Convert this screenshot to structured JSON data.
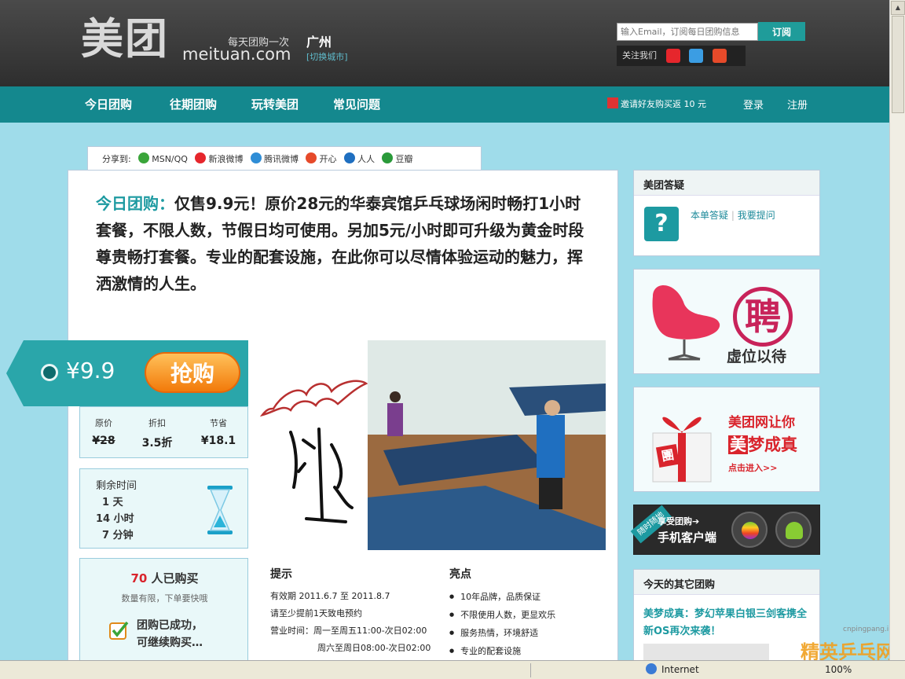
{
  "header": {
    "logo_cn": "美团",
    "logo_en": "meituan.com",
    "slogan": "每天团购一次",
    "city": "广州",
    "city_switch": "[切换城市]",
    "subscribe_placeholder": "输入Email，订阅每日团购信息",
    "subscribe_button": "订阅",
    "follow_label": "关注我们"
  },
  "nav": {
    "items": [
      "今日团购",
      "往期团购",
      "玩转美团",
      "常见问题"
    ],
    "invite": "邀请好友购买返 10 元",
    "login": "登录",
    "register": "注册"
  },
  "share": {
    "label": "分享到:",
    "items": [
      "MSN/QQ",
      "新浪微博",
      "腾讯微博",
      "开心",
      "人人",
      "豆瓣"
    ]
  },
  "deal": {
    "title_prefix": "今日团购：",
    "title": "仅售9.9元！原价28元的华泰宾馆乒乓球场闲时畅打1小时套餐，不限人数，节假日均可使用。另加5元/小时即可升级为黄金时段尊贵畅打套餐。专业的配套设施，在此你可以尽情体验运动的魅力，挥洒激情的人生。",
    "price": "¥9.9",
    "buy_button": "抢购",
    "original_label": "原价",
    "original_value": "¥28",
    "discount_label": "折扣",
    "discount_value": "3.5折",
    "save_label": "节省",
    "save_value": "¥18.1",
    "remaining_label": "剩余时间",
    "remaining_days": "1 天",
    "remaining_hours": "14 小时",
    "remaining_minutes": "7 分钟",
    "buyers_count": "70",
    "buyers_text": "人已购买",
    "limited_text": "数量有限，下单要快哦",
    "success_line1": "团购已成功，",
    "success_line2": "可继续购买…"
  },
  "tips": {
    "title": "提示",
    "lines": [
      "有效期 2011.6.7 至 2011.8.7",
      "请至少提前1天致电预约",
      "营业时间：周一至周五11:00-次日02:00",
      "周六至周日08:00-次日02:00"
    ]
  },
  "highlights": {
    "title": "亮点",
    "items": [
      "10年品牌，品质保证",
      "不限使用人数，更显欢乐",
      "服务热情，环境舒适",
      "专业的配套设施"
    ]
  },
  "sidebar": {
    "qa_title": "美团答疑",
    "qa_link1": "本单答疑",
    "qa_sep": "|",
    "qa_link2": "我要提问",
    "job_banner_char": "聘",
    "job_banner_text": "虚位以待",
    "dream_line1": "美团网让你",
    "dream_line2": "美梦成真",
    "dream_enter": "点击进入>>",
    "dream_seal": "美",
    "dream_box_char": "團",
    "mobile_tag": "随时随地",
    "mobile_line1": "享受团购➔",
    "mobile_line2": "手机客户端",
    "other_title": "今天的其它团购",
    "other_deal": "美梦成真：梦幻苹果白银三剑客携全新OS再次来袭！"
  },
  "statusbar": {
    "zone": "Internet",
    "zoom": "100%"
  },
  "watermark": {
    "domain": "cnpingpang.info",
    "text": "精英乒乓网"
  },
  "colors": {
    "teal": "#14888e",
    "accent": "#1d9aa1",
    "orange": "#f27a0a",
    "red": "#d9242c"
  }
}
